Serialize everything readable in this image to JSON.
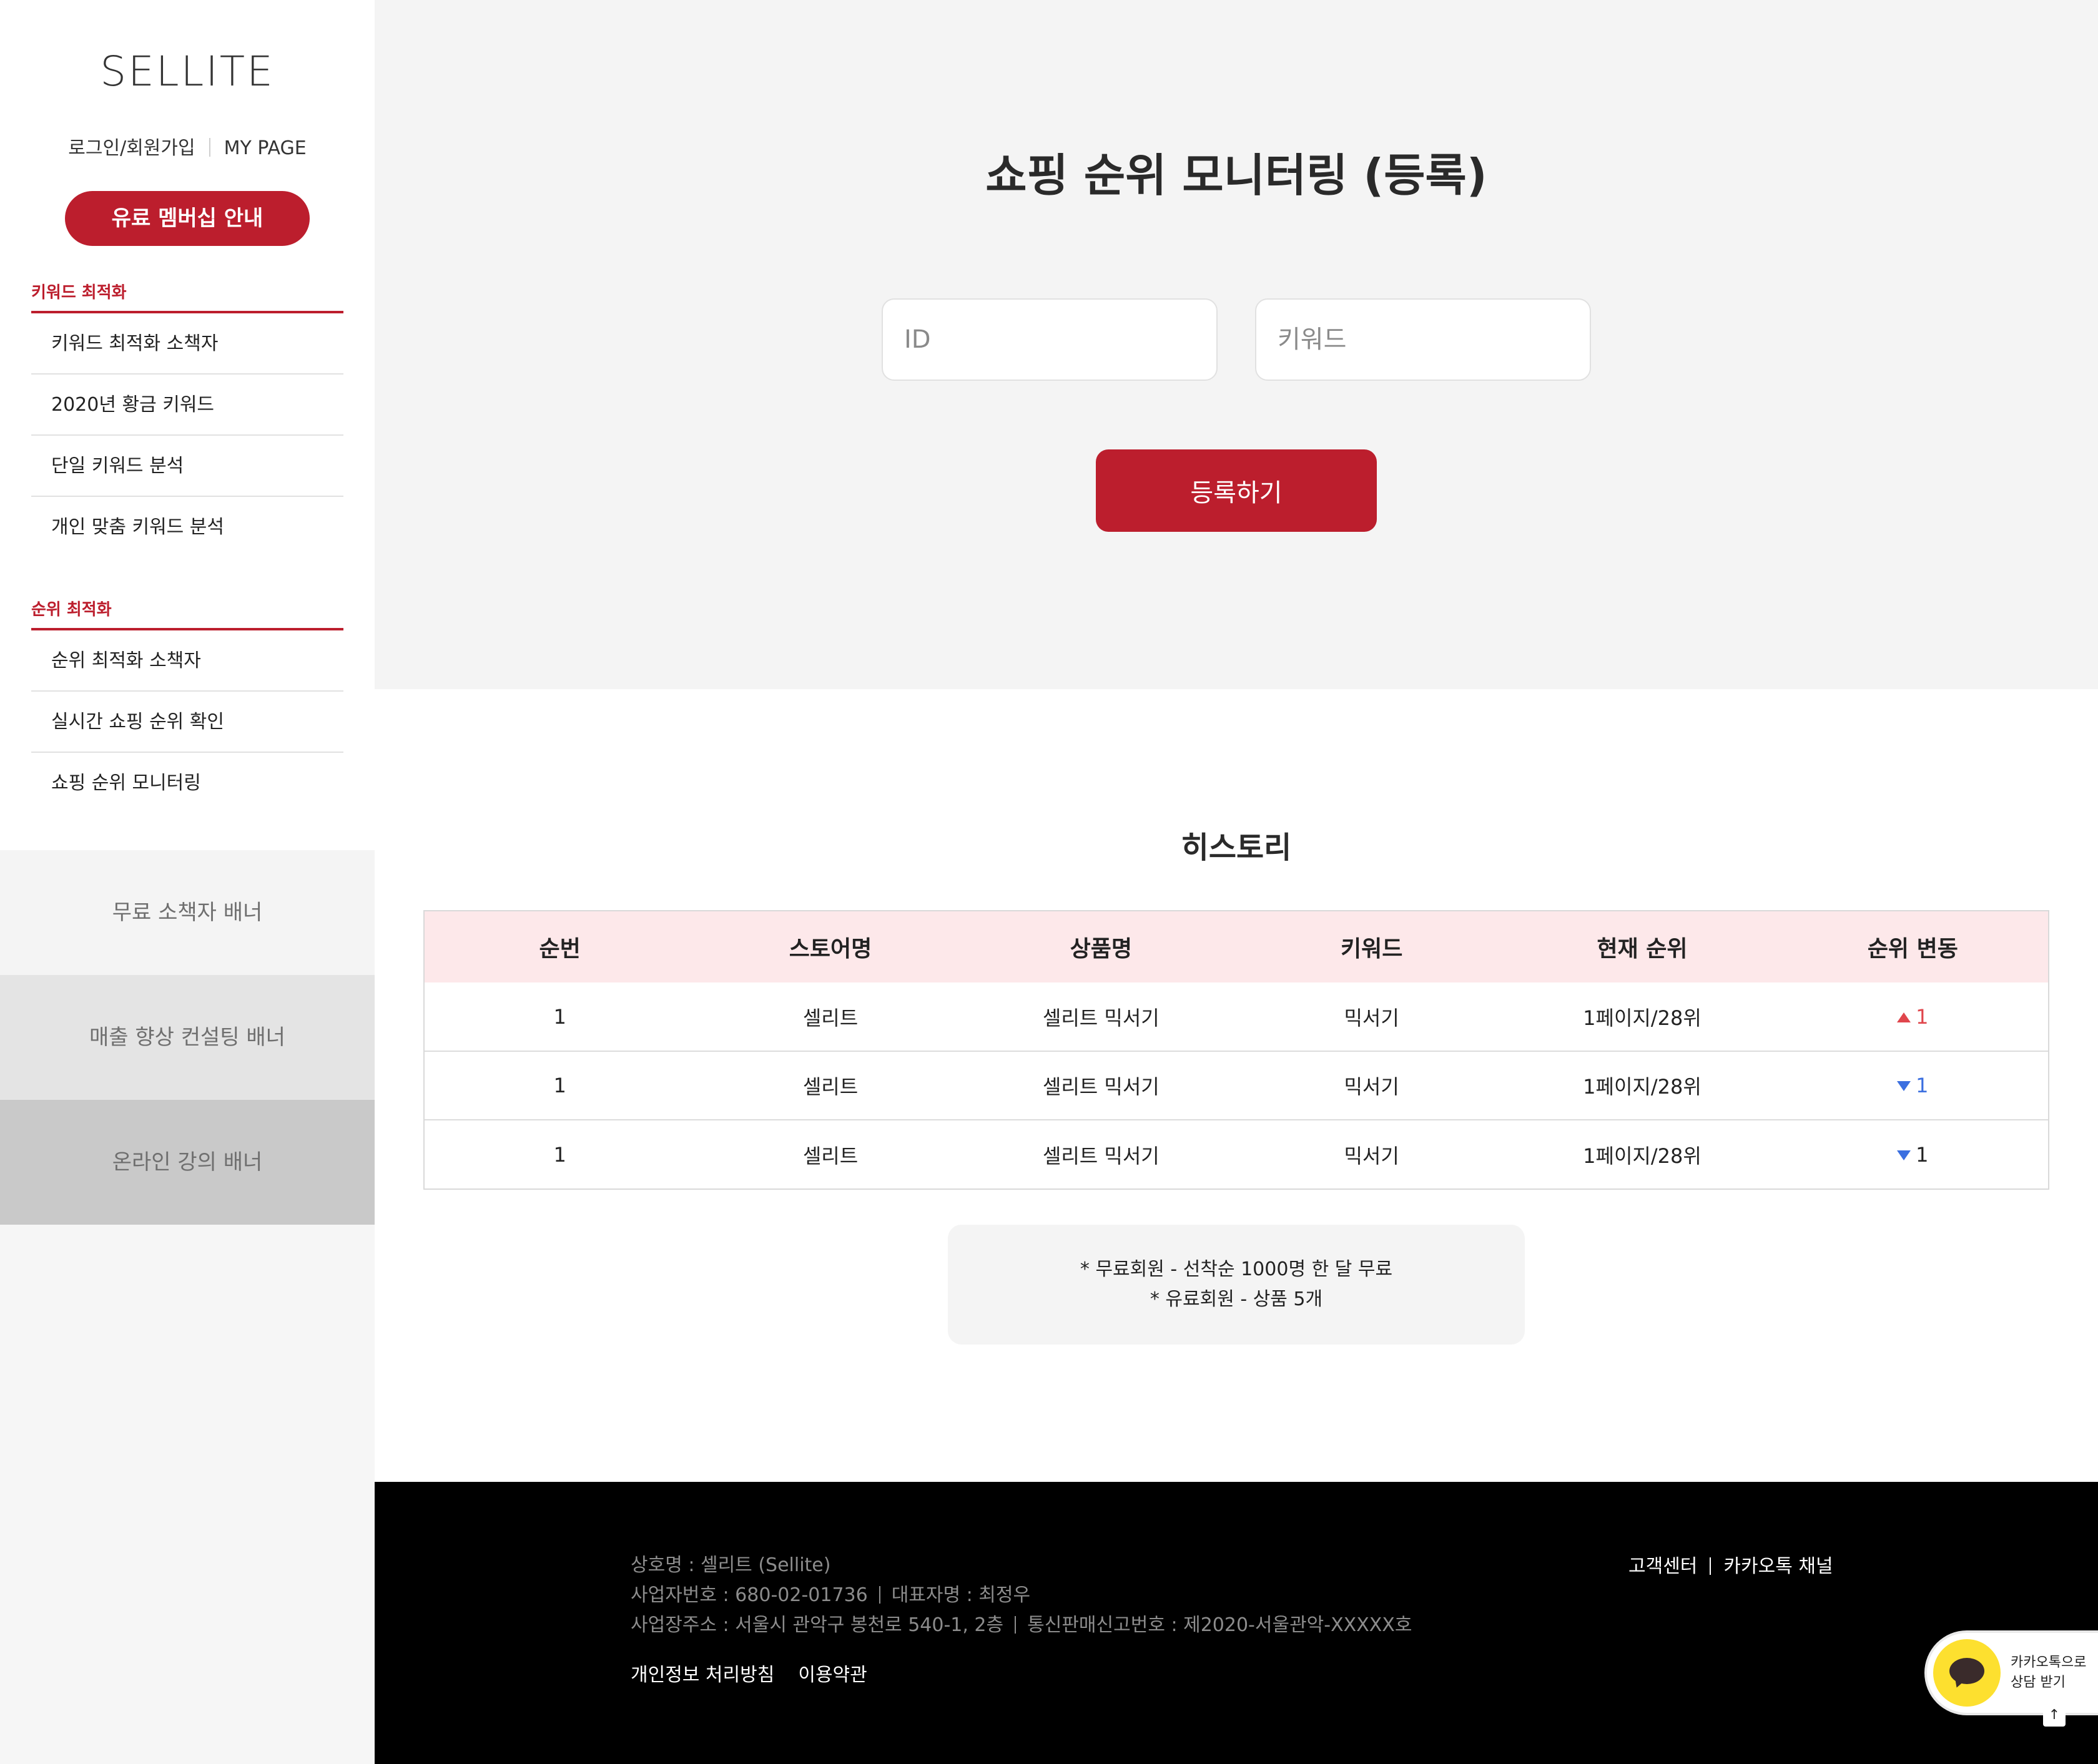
{
  "brand": {
    "logo": "SELLITE"
  },
  "auth": {
    "login_label": "로그인/회원가입",
    "mypage_label": "MY PAGE"
  },
  "membership_button": "유료 멤버십 안내",
  "sidebar": {
    "groups": [
      {
        "title": "키워드 최적화",
        "items": [
          {
            "label": "키워드 최적화 소책자"
          },
          {
            "label": "2020년 황금 키워드"
          },
          {
            "label": "단일 키워드 분석"
          },
          {
            "label": "개인 맞춤 키워드 분석"
          }
        ]
      },
      {
        "title": "순위 최적화",
        "items": [
          {
            "label": "순위 최적화 소책자"
          },
          {
            "label": "실시간 쇼핑 순위 확인"
          },
          {
            "label": "쇼핑 순위 모니터링"
          }
        ]
      }
    ],
    "banners": [
      {
        "label": "무료 소책자 배너"
      },
      {
        "label": "매출 향상 컨설팅 배너"
      },
      {
        "label": "온라인 강의 배너"
      }
    ]
  },
  "main": {
    "title": "쇼핑 순위 모니터링 (등록)",
    "id_input": {
      "placeholder": "ID",
      "value": ""
    },
    "keyword_input": {
      "placeholder": "키워드",
      "value": ""
    },
    "register_button": "등록하기"
  },
  "history": {
    "title": "히스토리",
    "columns": [
      "순번",
      "스토어명",
      "상품명",
      "키워드",
      "현재 순위",
      "순위 변동"
    ],
    "rows": [
      {
        "no": "1",
        "store": "셀리트",
        "product": "셀리트 믹서기",
        "keyword": "믹서기",
        "rank": "1페이지/28위",
        "change": "1",
        "direction": "up"
      },
      {
        "no": "1",
        "store": "셀리트",
        "product": "셀리트 믹서기",
        "keyword": "믹서기",
        "rank": "1페이지/28위",
        "change": "1",
        "direction": "down"
      },
      {
        "no": "1",
        "store": "셀리트",
        "product": "셀리트 믹서기",
        "keyword": "믹서기",
        "rank": "1페이지/28위",
        "change": "1",
        "direction": "down"
      }
    ]
  },
  "notice": {
    "line1": "* 무료회원 - 선착순 1000명 한 달 무료",
    "line2": "* 유료회원 - 상품 5개"
  },
  "footer": {
    "company": "상호명 : 셀리트 (Sellite)",
    "biz_number": "사업자번호 : 680-02-01736",
    "ceo": "대표자명 : 최정우",
    "address": "사업장주소 : 서울시 관악구 봉천로 540-1, 2층",
    "mail_order": "통신판매신고번호 : 제2020-서울관악-XXXXX호",
    "privacy_link": "개인정보 처리방침",
    "terms_link": "이용약관",
    "support_link": "고객센터",
    "kakao_link": "카카오톡 채널"
  },
  "kakao_widget": {
    "line1": "카카오톡으로",
    "line2": "상담 받기"
  },
  "top_arrow": "↑",
  "colors": {
    "accent": "#bc1e2d",
    "header_row": "#fde8ea",
    "up": "#e0464c",
    "down": "#3b6fe0",
    "kakao": "#fde02f"
  }
}
